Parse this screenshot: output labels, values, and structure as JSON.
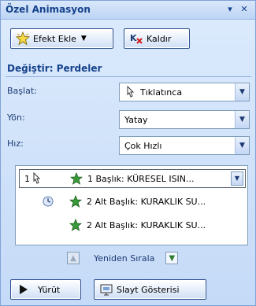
{
  "pane": {
    "title": "Özel Animasyon",
    "pin_glyph": "▾",
    "close_glyph": "✕"
  },
  "toolbar": {
    "add_effect_label": "Efekt Ekle",
    "remove_label": "Kaldır"
  },
  "modify": {
    "heading": "Değiştir: Perdeler",
    "start_label": "Başlat:",
    "start_value": "Tıklatınca",
    "direction_label": "Yön:",
    "direction_value": "Yatay",
    "speed_label": "Hız:",
    "speed_value": "Çok Hızlı"
  },
  "list": {
    "items": [
      {
        "number": "1",
        "text": "1 Başlık: KÜRESEL ISIN..."
      },
      {
        "number": "",
        "text": "2 Alt Başlık: KURAKLIK SU..."
      },
      {
        "number": "",
        "text": "2 Alt Başlık: KURAKLIK SU..."
      }
    ]
  },
  "reorder": {
    "label": "Yeniden Sırala"
  },
  "footer": {
    "play_label": "Yürüt",
    "slideshow_label": "Slayt Gösterisi"
  },
  "colors": {
    "accent": "#15428b",
    "pane_bg": "#c5daf7",
    "star_green": "#2f8a2f"
  }
}
